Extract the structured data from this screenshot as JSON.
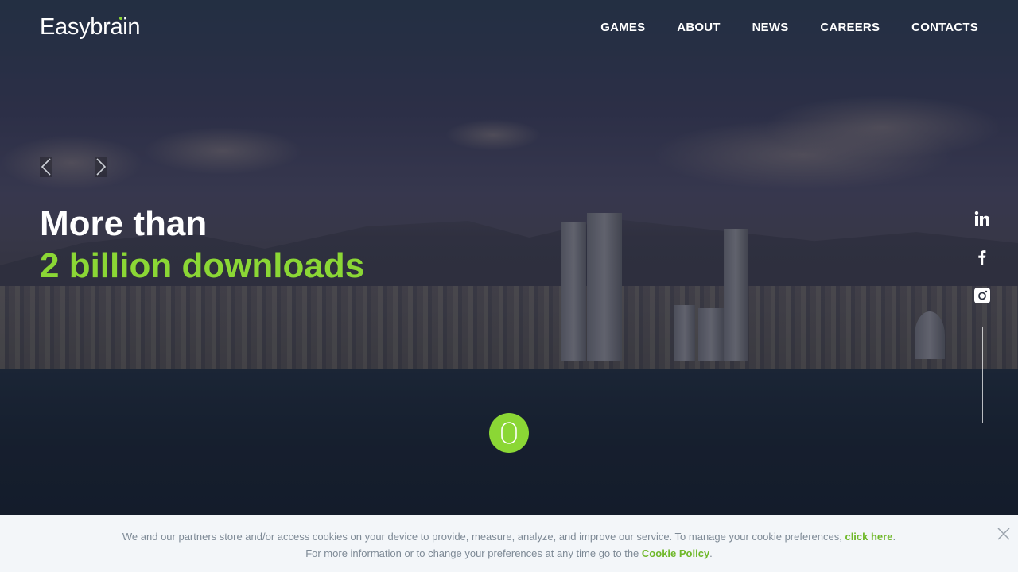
{
  "brand": {
    "logo": "Easybrain"
  },
  "nav": {
    "items": [
      {
        "label": "GAMES"
      },
      {
        "label": "ABOUT"
      },
      {
        "label": "NEWS"
      },
      {
        "label": "CAREERS"
      },
      {
        "label": "CONTACTS"
      }
    ]
  },
  "slider": {
    "prev_icon": "chevron-left-icon",
    "next_icon": "chevron-right-icon"
  },
  "hero": {
    "line1": "More than",
    "line2": "2 billion downloads"
  },
  "socials": [
    {
      "icon": "linkedin-icon"
    },
    {
      "icon": "facebook-icon"
    },
    {
      "icon": "instagram-icon"
    }
  ],
  "scroll": {
    "icon": "mouse-scroll-icon"
  },
  "cookie": {
    "line1_text": "We and our partners store and/or access cookies on your device to provide, measure, analyze, and improve our service. To manage your cookie preferences,",
    "line1_link": "click here",
    "line1_end": ".",
    "line2_text": "For more information or to change your preferences at any time go to the",
    "line2_link": "Cookie Policy",
    "line2_end": "."
  },
  "colors": {
    "accent": "#8bd735",
    "cookie_bg": "#f3f6f9",
    "cookie_text": "#7e8a96"
  }
}
